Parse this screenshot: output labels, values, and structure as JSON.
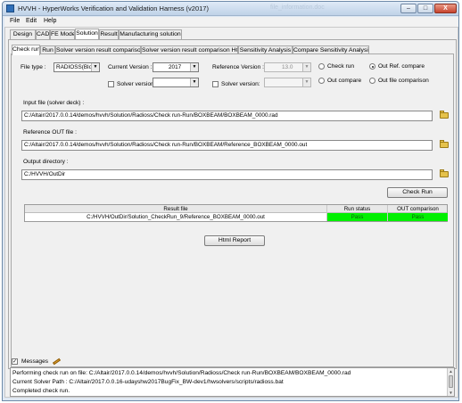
{
  "window": {
    "title": "HVVH - HyperWorks Verification and Validation Harness (v2017)",
    "ghost_title": "file_information.doc",
    "min_glyph": "–",
    "max_glyph": "□",
    "close_glyph": "X"
  },
  "menu": [
    "File",
    "Edit",
    "Help"
  ],
  "main_tabs": [
    "Design",
    "CAD",
    "FE Model",
    "Solution",
    "Result",
    "Manufacturing solution"
  ],
  "sub_tabs": [
    "Check run",
    "Run",
    "Solver version result comparison",
    "Solver version result comparison HG",
    "Sensitivity Analysis",
    "Compare Sensitivity Analysis"
  ],
  "form": {
    "file_type_label": "File type :",
    "file_type_value": "RADIOSS(Block)",
    "current_version_label": "Current Version :",
    "current_version_value": "2017",
    "reference_version_label": "Reference Version :",
    "reference_version_value": "13.0",
    "solver_version_label": "Solver version:",
    "solver_version_label_2": "Solver version:",
    "radio_check_run": "Check run",
    "radio_out_ref_compare": "Out Ref. compare",
    "radio_out_compare": "Out compare",
    "radio_out_file_comparison": "Out file comparison",
    "input_file_label": "Input file (solver deck) :",
    "input_file_value": "C:/Altair/2017.0.0.14/demos/hvvh/Solution/Radioss/Check run-Run/BOXBEAM/BOXBEAM_0000.rad",
    "reference_out_label": "Reference OUT file :",
    "reference_out_value": "C:/Altair/2017.0.0.14/demos/hvvh/Solution/Radioss/Check run-Run/BOXBEAM/Reference_BOXBEAM_0000.out",
    "output_dir_label": "Output directory :",
    "output_dir_value": "C:/HVVH/OutDir"
  },
  "buttons": {
    "check_run": "Check Run",
    "html_report": "Html Report"
  },
  "results": {
    "columns": [
      "Result file",
      "Run status",
      "OUT comparison"
    ],
    "rows": [
      {
        "file": "C:/HVVH/OutDir/Solution_CheckRun_9/Reference_BOXBEAM_0000.out",
        "run_status": "Pass",
        "out_comparison": "Pass"
      }
    ]
  },
  "messages": {
    "checkbox_glyph": "✓",
    "label": "Messages",
    "lines": [
      "Performing check run on file: C:/Altair/2017.0.0.14/demos/hvvh/Solution/Radioss/Check run-Run/BOXBEAM/BOXBEAM_0000.rad",
      "Current Solver Path : C:/Altair/2017.0.0.16-udayshw2017BugFix_BW-dev1/hwsolvers/scripts/radioss.bat",
      "Completed check run."
    ]
  },
  "colors": {
    "pass": "#00f000",
    "title_gradient_top": "#dfeaf7",
    "title_gradient_bottom": "#bfd2e8"
  }
}
